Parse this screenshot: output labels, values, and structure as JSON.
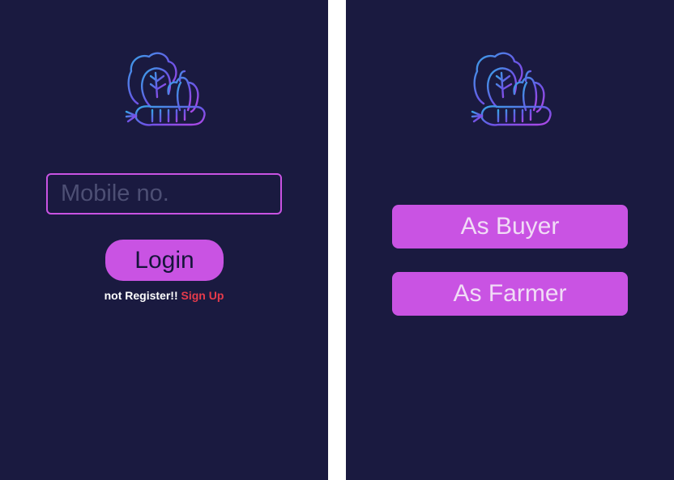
{
  "colors": {
    "screen_background": "#1a1a40",
    "accent": "#c953e3",
    "signup_link": "#e73b4b",
    "placeholder": "#4d4f74"
  },
  "logo": {
    "icon": "vegetables-icon"
  },
  "login_screen": {
    "mobile_placeholder": "Mobile no.",
    "login_label": "Login",
    "not_registered_text": "not Register!!",
    "signup_link_label": "Sign Up"
  },
  "role_screen": {
    "buyer_label": "As Buyer",
    "farmer_label": "As Farmer"
  }
}
